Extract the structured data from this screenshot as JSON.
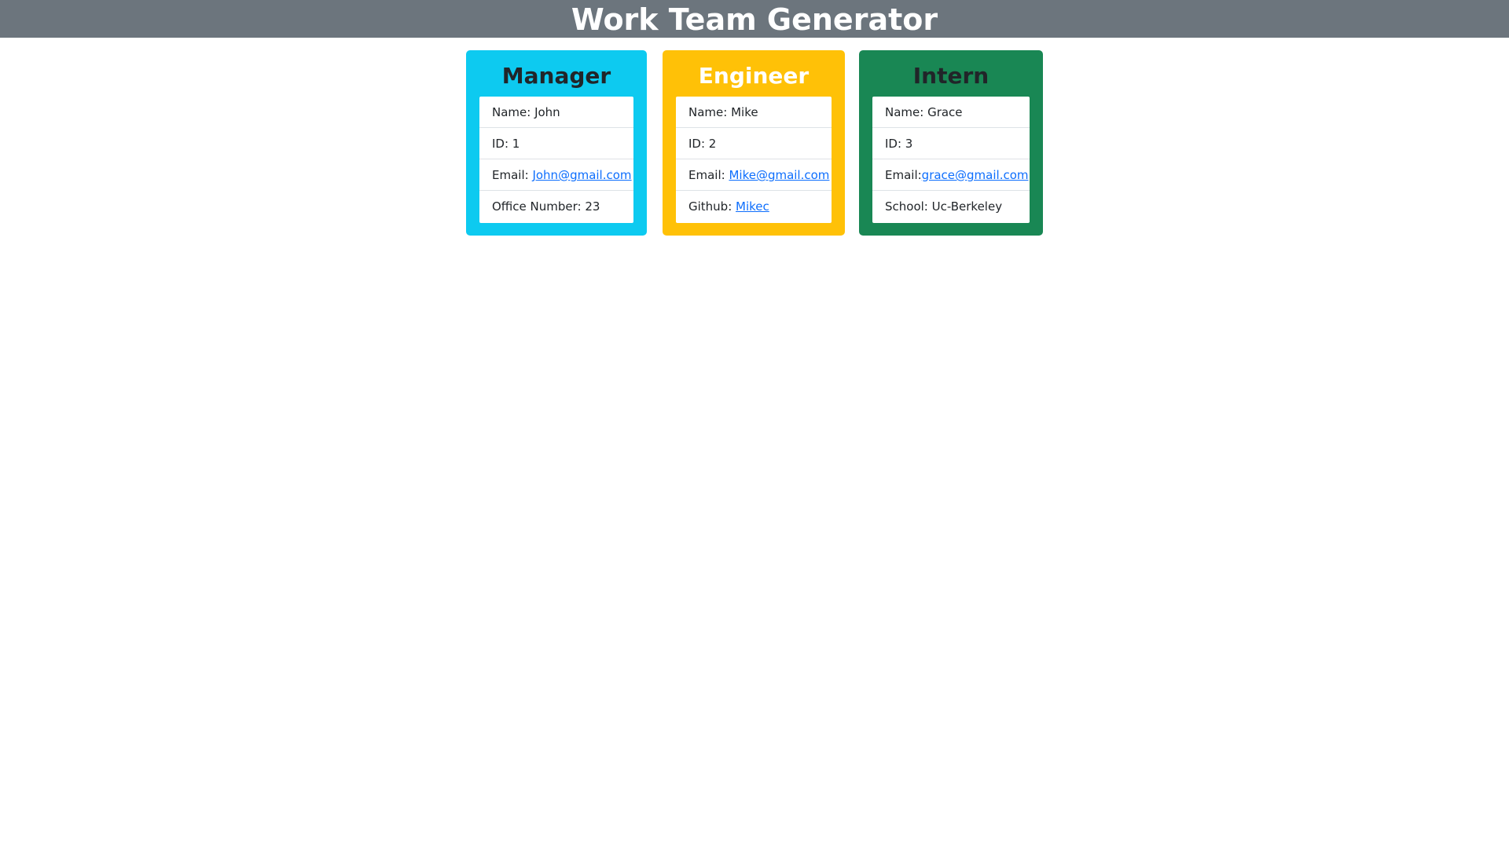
{
  "header": {
    "title": "Work Team Generator",
    "background": "#6c757d"
  },
  "cards": [
    {
      "role": "Manager",
      "color": "#0dcaf0",
      "title_color": "#212529",
      "items": [
        {
          "label": "Name: ",
          "value": "John"
        },
        {
          "label": "ID: ",
          "value": "1"
        },
        {
          "label": "Email: ",
          "link": "John@gmail.com"
        },
        {
          "label": "Office Number: ",
          "value": "23"
        }
      ]
    },
    {
      "role": "Engineer",
      "color": "#ffc107",
      "title_color": "#ffffff",
      "items": [
        {
          "label": "Name: ",
          "value": "Mike"
        },
        {
          "label": "ID: ",
          "value": "2"
        },
        {
          "label": "Email: ",
          "link": "Mike@gmail.com"
        },
        {
          "label": "Github: ",
          "link": "Mikec"
        }
      ]
    },
    {
      "role": "Intern",
      "color": "#198754",
      "title_color": "#212529",
      "items": [
        {
          "label": "Name: ",
          "value": "Grace"
        },
        {
          "label": "ID: ",
          "value": "3"
        },
        {
          "label": "Email:",
          "link": "grace@gmail.com"
        },
        {
          "label": "School: ",
          "value": "Uc-Berkeley"
        }
      ]
    }
  ]
}
